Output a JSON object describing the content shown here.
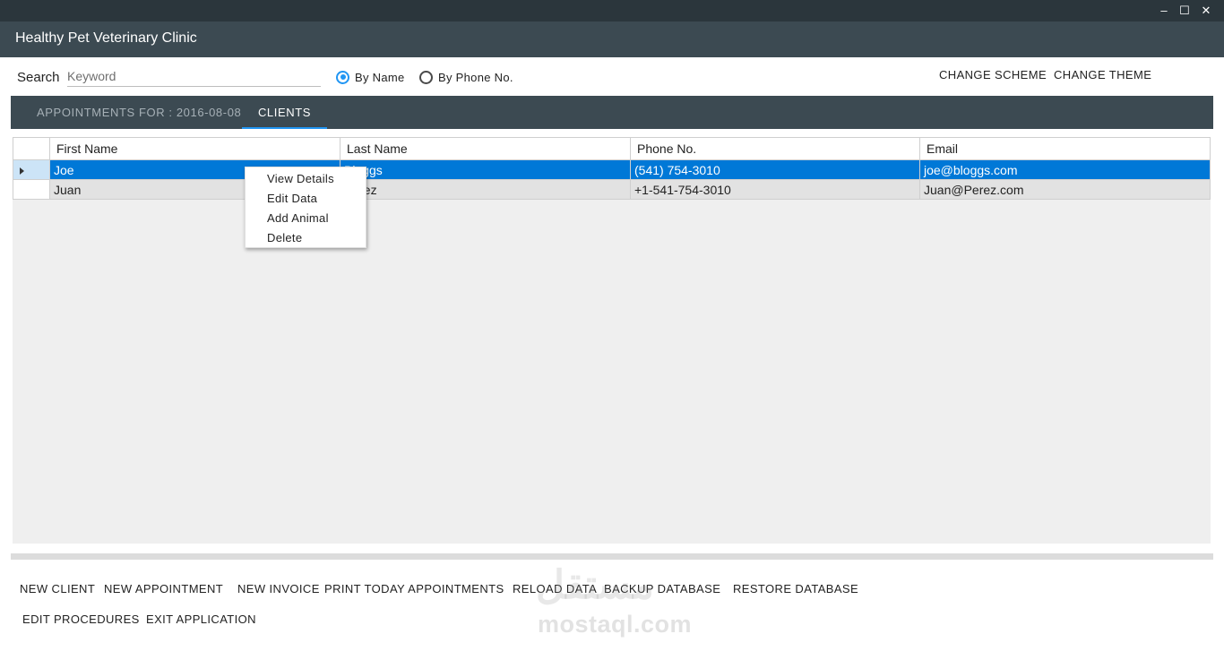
{
  "window": {
    "title": "Healthy Pet Veterinary Clinic",
    "controls": [
      "–",
      "☐",
      "✕"
    ]
  },
  "search": {
    "label": "Search",
    "placeholder": "Keyword",
    "value": "",
    "by_name_label": "By Name",
    "by_phone_label": "By Phone No.",
    "selected": "by_name"
  },
  "top_actions": {
    "change_scheme": "CHANGE SCHEME",
    "change_theme": "CHANGE THEME"
  },
  "tabs": [
    {
      "label": "APPOINTMENTS FOR : 2016-08-08",
      "active": false
    },
    {
      "label": "CLIENTS",
      "active": true
    }
  ],
  "grid": {
    "columns": [
      "First Name",
      "Last Name",
      "Phone No.",
      "Email"
    ],
    "rows": [
      {
        "first": "Joe",
        "last": "Bloggs",
        "phone": "(541) 754-3010",
        "email": "joe@bloggs.com",
        "selected": true
      },
      {
        "first": "Juan",
        "last": "Perez",
        "phone": "+1-541-754-3010",
        "email": "Juan@Perez.com",
        "selected": false
      }
    ]
  },
  "context_menu": {
    "items": [
      "View Details",
      "Edit Data",
      "Add Animal",
      "Delete"
    ]
  },
  "bottom_actions": {
    "new_client": "NEW CLIENT",
    "new_appointment": "NEW APPOINTMENT",
    "new_invoice": "NEW INVOICE",
    "print_today": "PRINT TODAY APPOINTMENTS",
    "reload_data": "RELOAD DATA",
    "backup_db": "BACKUP DATABASE",
    "restore_db": "RESTORE DATABASE",
    "edit_procedures": "EDIT PROCEDURES",
    "exit_app": "EXIT APPLICATION"
  },
  "watermark": {
    "arabic": "مستقل",
    "latin": "mostaql.com"
  },
  "colors": {
    "accent": "#2196f3",
    "titlebar": "#3c4a52",
    "topbar": "#2b363c",
    "selected_row": "#0078d7"
  }
}
